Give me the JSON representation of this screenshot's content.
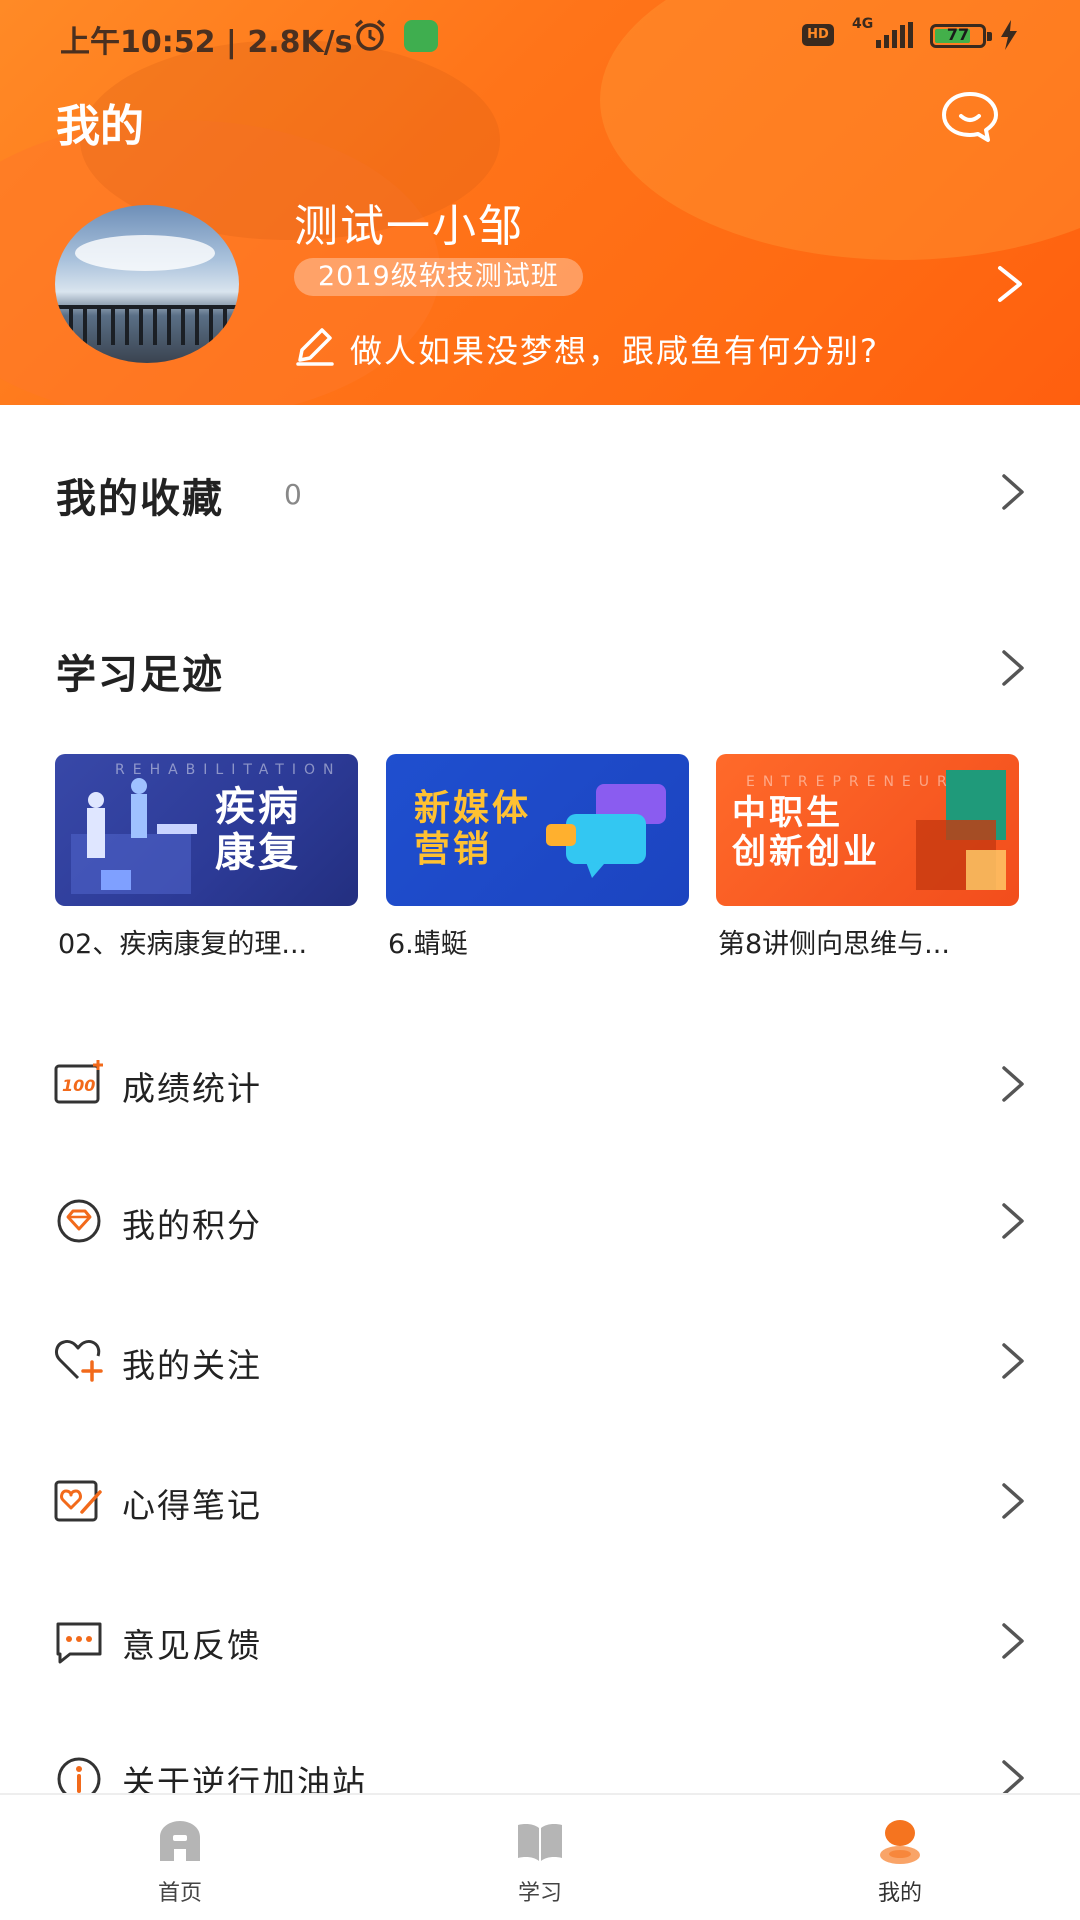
{
  "status_bar": {
    "time_speed": "上午10:52 | 2.8K/s",
    "hd": "HD",
    "network": "4G",
    "battery_level": "77",
    "battery_fraction": 0.77
  },
  "header": {
    "title": "我的",
    "user_name": "测试一小邹",
    "class_badge": "2019级软技测试班",
    "motto": "做人如果没梦想，跟咸鱼有何分别?"
  },
  "favorites": {
    "title": "我的收藏",
    "count": "0"
  },
  "footprint": {
    "title": "学习足迹",
    "cards": [
      {
        "cover_text": "疾病\n康复",
        "cover_sub": "REHABILITATION",
        "caption": "02、疾病康复的理..."
      },
      {
        "cover_text": "新媒体\n营销",
        "cover_sub": "",
        "caption": "6.蜻蜓"
      },
      {
        "cover_text": "中职生\n创新创业",
        "cover_sub": "ENTREPRENEUR",
        "caption": "第8讲侧向思维与..."
      }
    ]
  },
  "menu": [
    {
      "label": "成绩统计",
      "icon": "score-100-icon"
    },
    {
      "label": "我的积分",
      "icon": "points-diamond-icon"
    },
    {
      "label": "我的关注",
      "icon": "follow-heart-icon"
    },
    {
      "label": "心得笔记",
      "icon": "notes-heart-icon"
    },
    {
      "label": "意见反馈",
      "icon": "feedback-chat-icon"
    },
    {
      "label": "关于逆行加油站",
      "icon": "info-icon"
    }
  ],
  "tabbar": {
    "tabs": [
      {
        "label": "首页",
        "icon": "home-icon"
      },
      {
        "label": "学习",
        "icon": "book-icon"
      },
      {
        "label": "我的",
        "icon": "profile-icon"
      }
    ],
    "active": "我的"
  },
  "colors": {
    "brand_orange": "#ff7419",
    "icon_accent": "#f26a1b"
  }
}
